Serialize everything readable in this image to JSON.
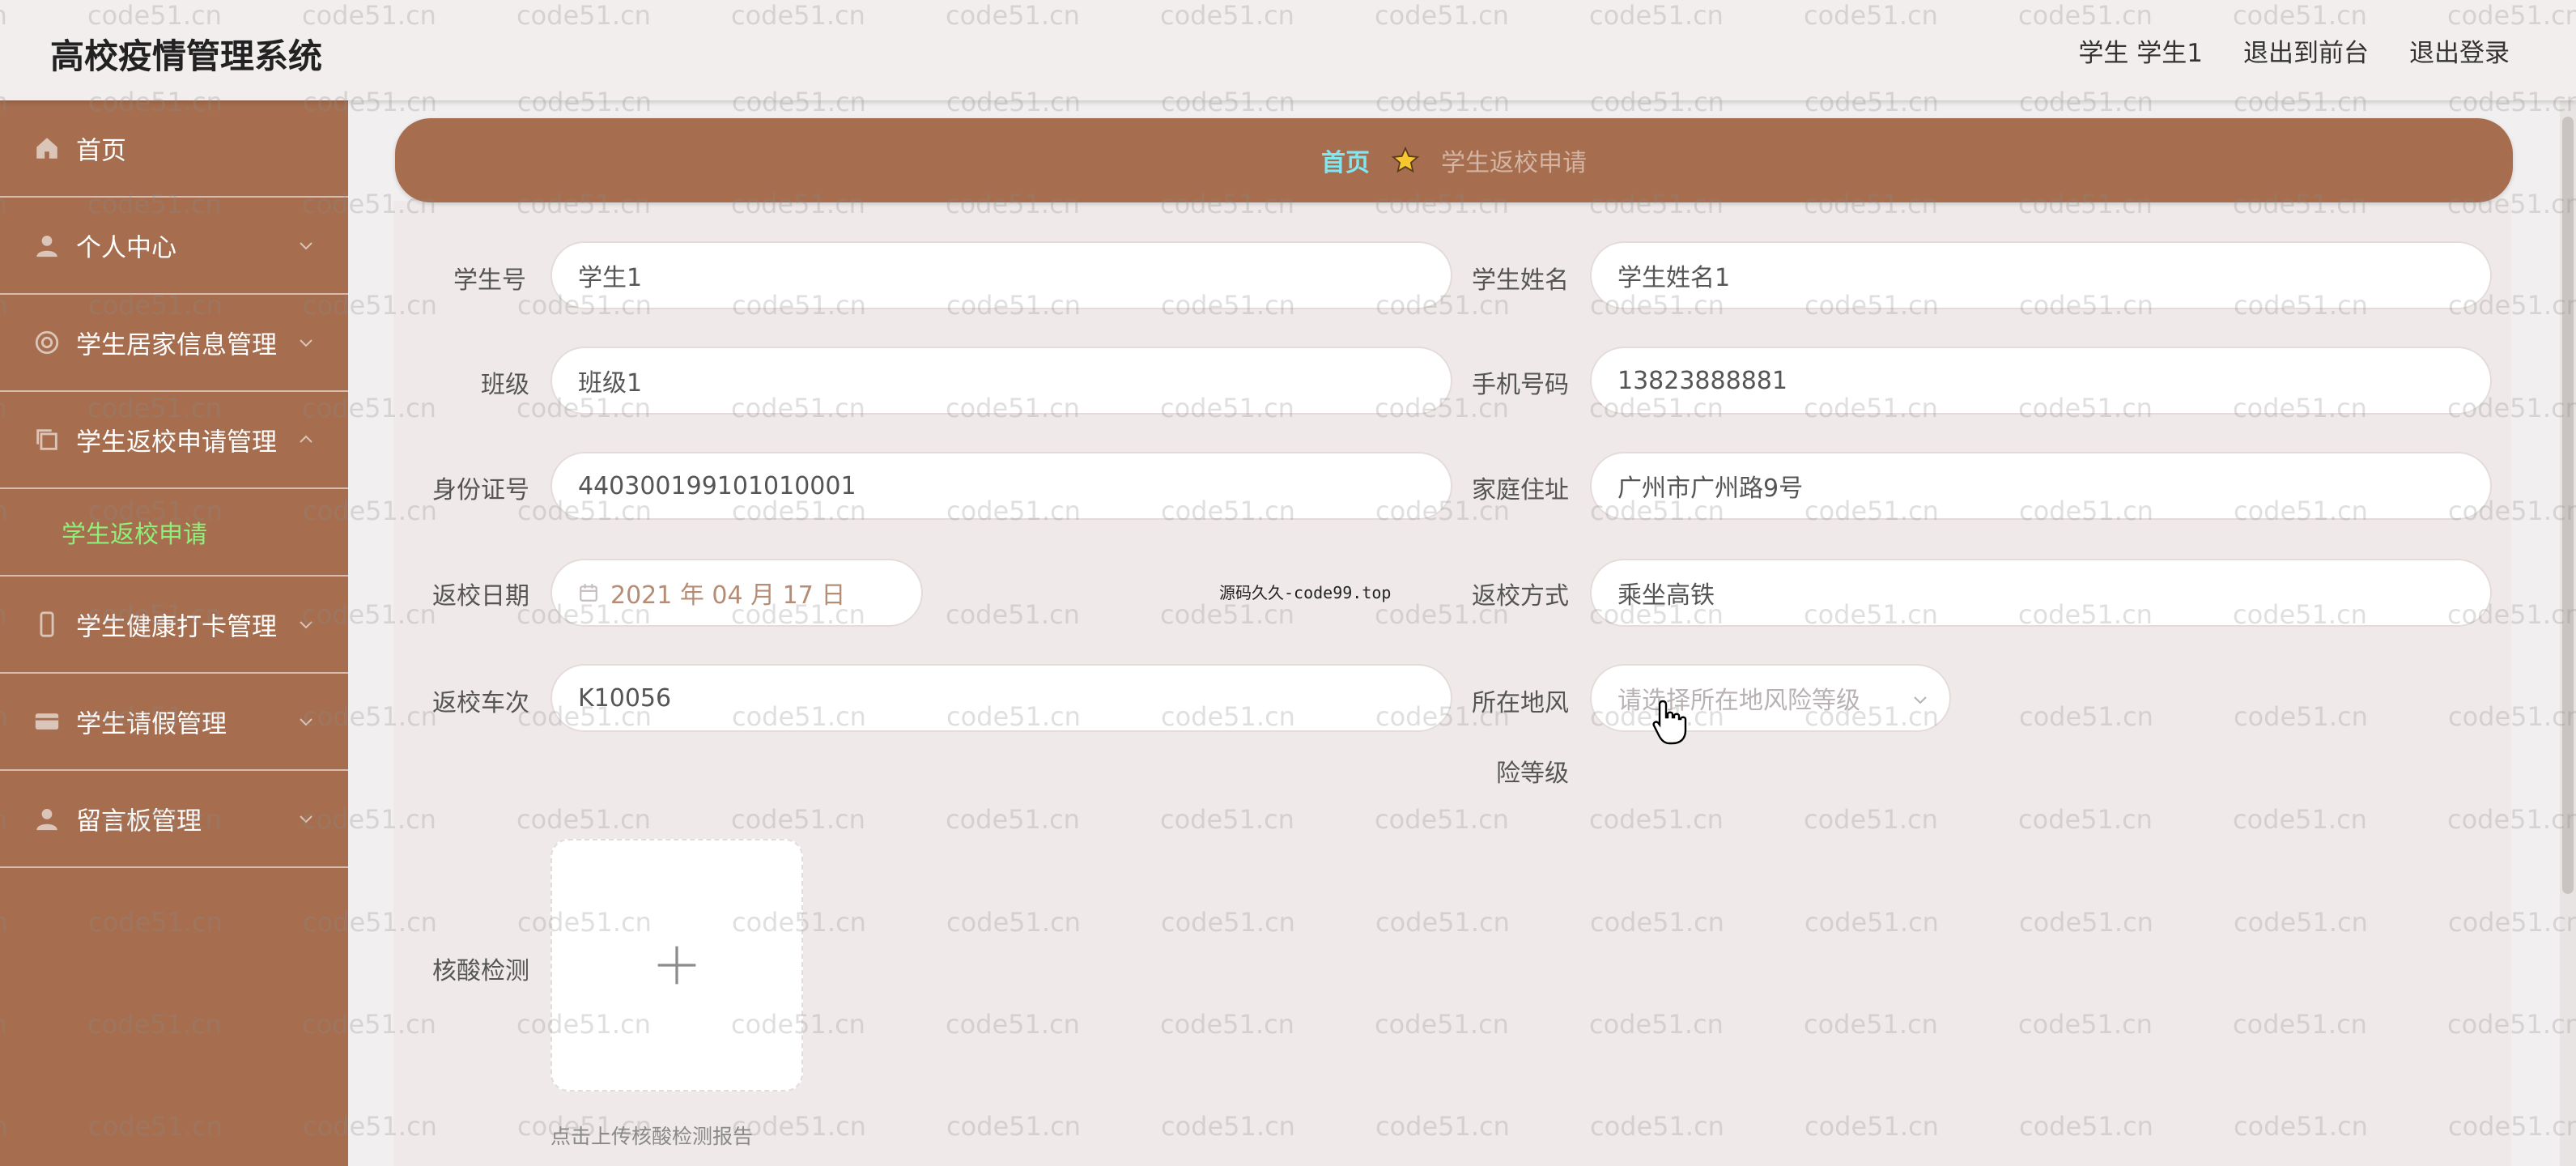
{
  "app": {
    "title": "高校疫情管理系统"
  },
  "header": {
    "user_label": "学生 学生1",
    "to_front_label": "退出到前台",
    "logout_label": "退出登录"
  },
  "sidebar": {
    "items": [
      {
        "label": "首页",
        "icon": "home-icon"
      },
      {
        "label": "个人中心",
        "icon": "user-icon"
      },
      {
        "label": "学生居家信息管理",
        "icon": "globe-icon"
      },
      {
        "label": "学生返校申请管理",
        "icon": "copy-icon",
        "expanded": true
      },
      {
        "label": "学生健康打卡管理",
        "icon": "phone-icon"
      },
      {
        "label": "学生请假管理",
        "icon": "card-icon"
      },
      {
        "label": "留言板管理",
        "icon": "person-icon"
      }
    ],
    "submenu": [
      {
        "label": "学生返校申请",
        "active": true
      }
    ]
  },
  "breadcrumb": {
    "home": "首页",
    "current": "学生返校申请"
  },
  "form": {
    "student_no": {
      "label": "学生号",
      "value": "学生1"
    },
    "student_name": {
      "label": "学生姓名",
      "value": "学生姓名1"
    },
    "class": {
      "label": "班级",
      "value": "班级1"
    },
    "phone": {
      "label": "手机号码",
      "value": "13823888881"
    },
    "id_card": {
      "label": "身份证号",
      "value": "440300199101010001"
    },
    "address": {
      "label": "家庭住址",
      "value": "广州市广州路9号"
    },
    "return_date": {
      "label": "返校日期",
      "value": "2021 年 04 月 17 日"
    },
    "return_method": {
      "label": "返校方式",
      "value": "乘坐高铁"
    },
    "train_no": {
      "label": "返校车次",
      "value": "K10056"
    },
    "risk_level": {
      "label_line1": "所在地风",
      "label_line2": "险等级",
      "placeholder": "请选择所在地风险等级"
    },
    "nucleic_test": {
      "label": "核酸检测",
      "upload_tip": "点击上传核酸检测报告"
    }
  },
  "overlay": {
    "center_note": "源码久久-code99.top",
    "watermark": "code51.cn"
  },
  "colors": {
    "sidebar_bg": "#a66e4f",
    "active_submenu": "#8ef07a",
    "breadcrumb_home": "#7ee7f2",
    "star": "#f6c730"
  }
}
